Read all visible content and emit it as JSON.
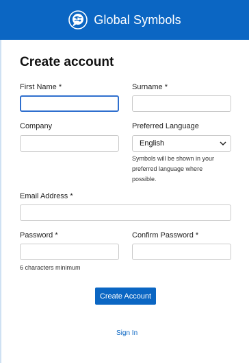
{
  "header": {
    "brand": "Global Symbols"
  },
  "form": {
    "title": "Create account",
    "first_name_label": "First Name *",
    "first_name_value": "",
    "surname_label": "Surname *",
    "surname_value": "",
    "company_label": "Company",
    "company_value": "",
    "language_label": "Preferred Language",
    "language_value": "English",
    "language_help": "Symbols will be shown in your preferred language where possible.",
    "email_label": "Email Address *",
    "email_value": "",
    "password_label": "Password *",
    "password_value": "",
    "password_help": "6 characters minimum",
    "confirm_label": "Confirm Password *",
    "confirm_value": "",
    "submit_label": "Create Account",
    "signin_label": "Sign In"
  },
  "colors": {
    "primary": "#0b66c3",
    "focus": "#2f6fce"
  },
  "icons": {
    "logo": "globe-speech-bubble-icon",
    "select_arrow": "chevron-down-icon"
  }
}
